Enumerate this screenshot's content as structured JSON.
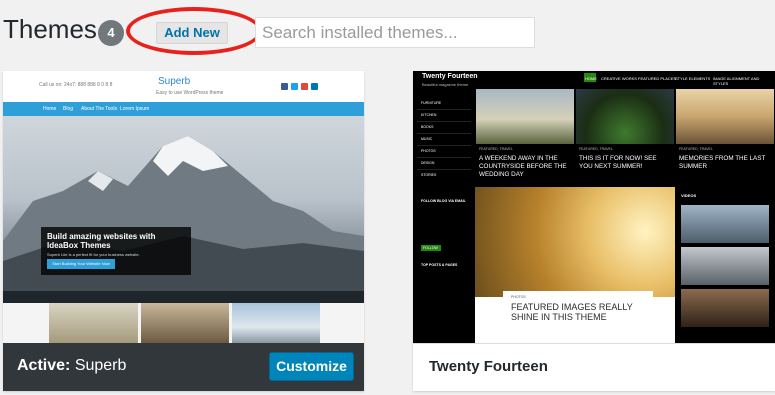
{
  "header": {
    "title": "Themes",
    "count": "4",
    "add_new_label": "Add New",
    "search_placeholder": "Search installed themes..."
  },
  "colors": {
    "accent": "#0085ba",
    "highlight_circle": "#e8221b",
    "active_bar": "#32373c",
    "superb_blue": "#2e9fd8",
    "tf_green": "#24890d"
  },
  "themes": [
    {
      "name": "Superb",
      "active": true,
      "bar_prefix": "Active:",
      "action_label": "Customize",
      "preview": {
        "contact": "Call us on: 24x7: 888 888 8 0 8 8",
        "site_title": "Superb",
        "tagline": "Easy to use WordPress theme",
        "nav": [
          "Home",
          "Blog",
          "About The Tools",
          "Lorem Ipsum"
        ],
        "hero_title": "Build amazing websites with IdeaBox Themes",
        "hero_sub": "Superb Lite is a perfect fit for your business website.",
        "hero_button": "Start Building Your Website Now"
      }
    },
    {
      "name": "Twenty Fourteen",
      "active": false,
      "preview": {
        "site_name": "Twenty Fourteen",
        "description": "Beautiful magazine theme",
        "menu": [
          "HOME",
          "CREATIVE WORKS",
          "FEATURED PLACES",
          "STYLE ELEMENTS",
          "IMAGE ALIGNMENT AND STYLES"
        ],
        "sidebar_items": [
          "FURNITURE",
          "KITCHEN",
          "BOOKS",
          "MUSIC",
          "PHOTOS",
          "DESIGN",
          "STORIES"
        ],
        "follow_label": "FOLLOW BLOG VIA EMAIL",
        "follow_button": "FOLLOW",
        "popular_label": "TOP POSTS & PAGES",
        "grid": [
          {
            "category": "FEATURED, TRAVEL",
            "caption": "A WEEKEND AWAY IN THE COUNTRYSIDE BEFORE THE WEDDING DAY"
          },
          {
            "category": "FEATURED, TRAVEL",
            "caption": "THIS IS IT FOR NOW! SEE YOU NEXT SUMMER!"
          },
          {
            "category": "FEATURED, TRAVEL",
            "caption": "MEMORIES FROM THE LAST SUMMER"
          }
        ],
        "featured_category": "PHOTOS",
        "featured_title": "FEATURED IMAGES REALLY SHINE IN THIS THEME",
        "videos_label": "VIDEOS"
      }
    }
  ]
}
